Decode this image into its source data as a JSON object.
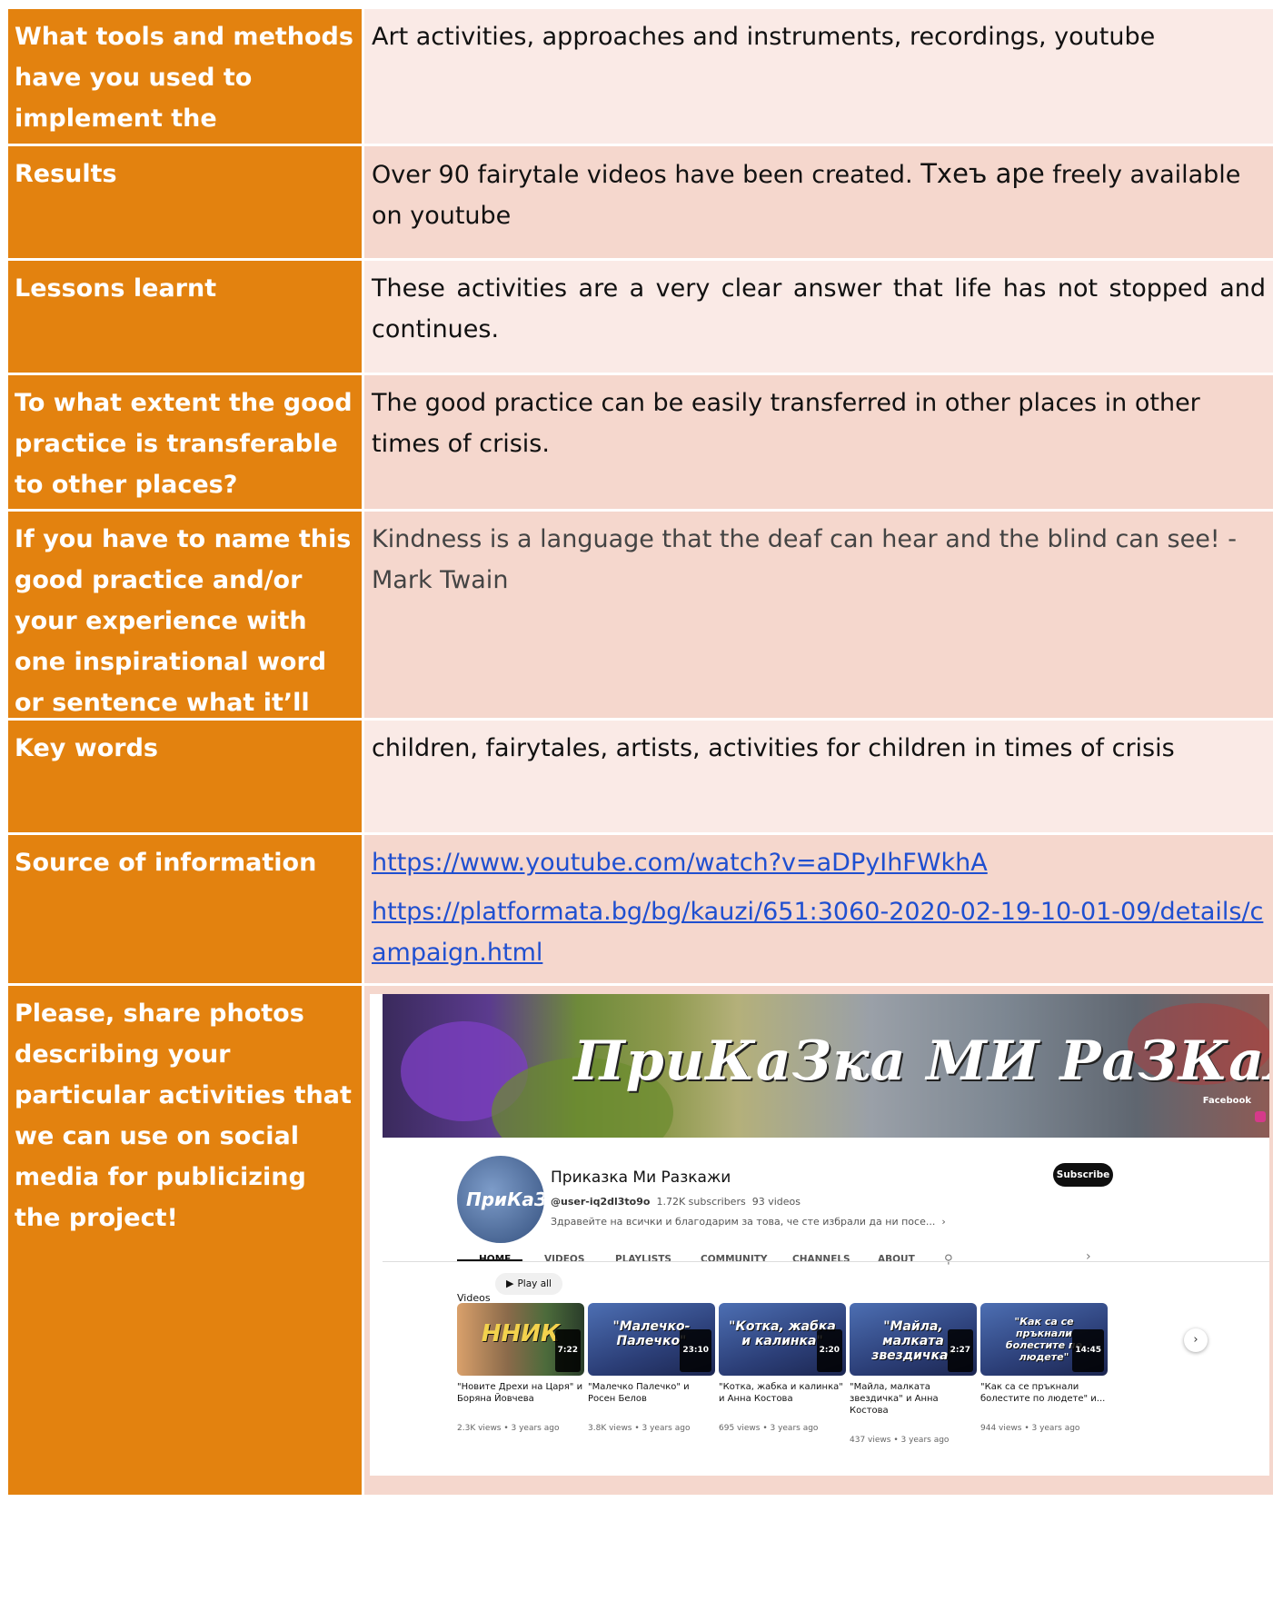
{
  "rows": [
    {
      "label": "What tools and methods have you used to implement the activities?",
      "value": "Art activities, approaches and instruments, recordings, youtube"
    },
    {
      "label": "Results",
      "value_a": "Over 90 fairytale videos have been created. ",
      "value_b": "Тхеъ аре",
      "value_c": " freely available on youtube"
    },
    {
      "label": "Lessons learnt",
      "value": "These activities are a very clear answer that life has not stopped and continues."
    },
    {
      "label": "To what extent the good practice is transferable to other places?",
      "value": "The good practice can be easily transferred in other places in other times of crisis."
    },
    {
      "label": "If you have to name this good practice and/or your experience with one inspirational word or sentence what it’ll be?",
      "value": "Kindness is a language that the deaf can hear and the blind can see! - Mark Twain"
    },
    {
      "label": "Key words",
      "value": "children, fairytales, artists, activities for children in times of crisis"
    },
    {
      "label": "Source of information",
      "link1": "https://www.youtube.com/watch?v=aDPyIhFWkhA",
      "link2": "https://platformata.bg/bg/kauzi/651:3060-2020-02-19-10-01-09/details/campaign.html"
    },
    {
      "label": "Please, share photos describing your particular activities that we can use on social media for publicizing the project!"
    }
  ],
  "youtube": {
    "banner_title": "ПриКаЗка МИ РаЗКаЖИ",
    "banner_facebook": "Facebook",
    "avatar_text": "ПриКаЗка",
    "channel_name": "Приказка Ми Разкажи",
    "handle": "@user-iq2dl3to9o",
    "subscribers": "1.72K subscribers",
    "video_count": "93 videos",
    "description": "Здравейте на всички и благодарим за това, че сте избрали да ни посе...",
    "subscribe_label": "Subscribe",
    "tabs": [
      "HOME",
      "VIDEOS",
      "PLAYLISTS",
      "COMMUNITY",
      "CHANNELS",
      "ABOUT"
    ],
    "videos_label": "Videos",
    "play_all_label": "Play all",
    "videos": [
      {
        "thumb_text": "ННИК",
        "duration": "7:22",
        "title": "\"Новите Дрехи на Царя\" и Боряна Йовчева",
        "meta": "2.3K views • 3 years ago"
      },
      {
        "thumb_text": "\"Малечко-Палечко\"",
        "duration": "23:10",
        "title": "\"Малечко Палечко\" и Росен Белов",
        "meta": "3.8K views • 3 years ago"
      },
      {
        "thumb_text": "\"Котка, жабка и калинка\"",
        "duration": "2:20",
        "title": "\"Котка, жабка и калинка\" и Анна Костова",
        "meta": "695 views • 3 years ago"
      },
      {
        "thumb_text": "\"Майла, малката звездичка\"",
        "duration": "2:27",
        "title": "\"Майла, малката звездичка\" и Анна Костова",
        "meta": "437 views • 3 years ago"
      },
      {
        "thumb_text": "\"Как са се пръкнали болестите по людете\"",
        "duration": "14:45",
        "title": "\"Как са се пръкнали болестите по людете\" и...",
        "meta": "944 views • 3 years ago"
      }
    ]
  }
}
